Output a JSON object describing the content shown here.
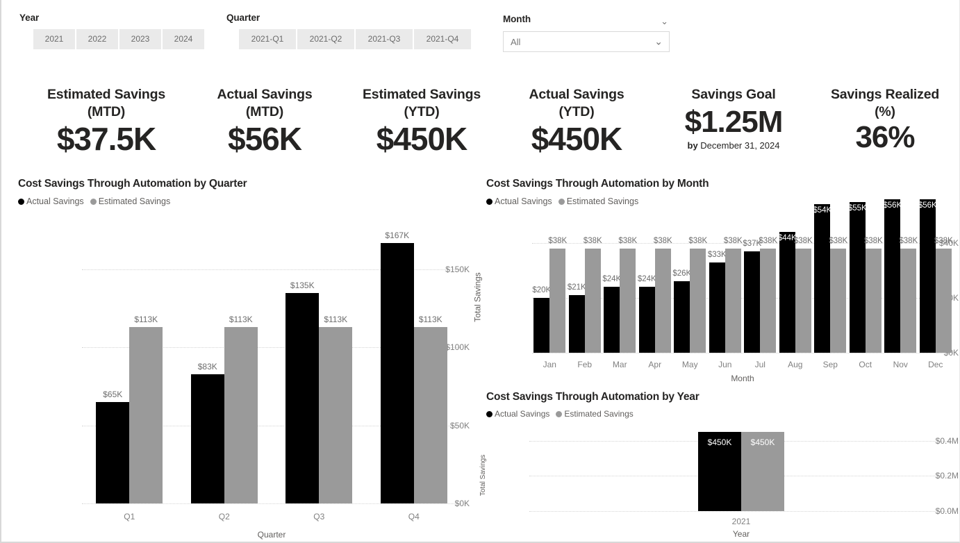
{
  "slicers": {
    "year": {
      "label": "Year",
      "options": [
        "2021",
        "2022",
        "2023",
        "2024"
      ]
    },
    "quarter": {
      "label": "Quarter",
      "options": [
        "2021-Q1",
        "2021-Q2",
        "2021-Q3",
        "2021-Q4"
      ]
    },
    "month": {
      "label": "Month",
      "value": "All",
      "caret_icon": "chevron-down-icon",
      "dropdown_icon": "chevron-down-icon"
    }
  },
  "kpis": [
    {
      "title_line1": "Estimated Savings",
      "title_line2": "(MTD)",
      "value": "$37.5K"
    },
    {
      "title_line1": "Actual Savings",
      "title_line2": "(MTD)",
      "value": "$56K"
    },
    {
      "title_line1": "Estimated Savings",
      "title_line2": "(YTD)",
      "value": "$450K"
    },
    {
      "title_line1": "Actual Savings",
      "title_line2": "(YTD)",
      "value": "$450K"
    },
    {
      "title_line1": "Savings Goal",
      "title_line2": "",
      "value": "$1.25M",
      "sub_prefix": "by",
      "sub_text": "December 31, 2024"
    },
    {
      "title_line1": "Savings Realized",
      "title_line2": "(%)",
      "value": "36%"
    }
  ],
  "colors": {
    "actual": "#000000",
    "estimated": "#9a9a9a",
    "text": "#252423",
    "axis": "#808080",
    "grid": "#d4d4d4"
  },
  "chart_data": [
    {
      "id": "quarter",
      "type": "bar",
      "title": "Cost Savings Through Automation by Quarter",
      "xlabel": "Quarter",
      "ylabel": "Total Savings",
      "categories": [
        "Q1",
        "Q2",
        "Q3",
        "Q4"
      ],
      "series": [
        {
          "name": "Actual Savings",
          "color": "#000000",
          "values": [
            65000,
            83000,
            135000,
            167000
          ],
          "labels": [
            "$65K",
            "$83K",
            "$135K",
            "$167K"
          ]
        },
        {
          "name": "Estimated Savings",
          "color": "#9a9a9a",
          "values": [
            113000,
            113000,
            113000,
            113000
          ],
          "labels": [
            "$113K",
            "$113K",
            "$113K",
            "$113K"
          ]
        }
      ],
      "yticks": [
        0,
        50000,
        100000,
        150000
      ],
      "ytick_labels": [
        "$0K",
        "$50K",
        "$100K",
        "$150K"
      ],
      "ylim": [
        0,
        175000
      ],
      "grid": true,
      "legend_position": "top-left"
    },
    {
      "id": "month",
      "type": "bar",
      "title": "Cost Savings Through Automation by Month",
      "xlabel": "Month",
      "ylabel": "Total Savings",
      "categories": [
        "Jan",
        "Feb",
        "Mar",
        "Apr",
        "May",
        "Jun",
        "Jul",
        "Aug",
        "Sep",
        "Oct",
        "Nov",
        "Dec"
      ],
      "series": [
        {
          "name": "Actual Savings",
          "color": "#000000",
          "values": [
            20000,
            21000,
            24000,
            24000,
            26000,
            33000,
            37000,
            44000,
            54000,
            55000,
            56000,
            56000
          ],
          "labels": [
            "$20K",
            "$21K",
            "$24K",
            "$24K",
            "$26K",
            "$33K",
            "$37K",
            "$44K",
            "$54K",
            "$55K",
            "$56K",
            "$56K"
          ]
        },
        {
          "name": "Estimated Savings",
          "color": "#9a9a9a",
          "values": [
            38000,
            38000,
            38000,
            38000,
            38000,
            38000,
            38000,
            38000,
            38000,
            38000,
            38000,
            38000
          ],
          "labels": [
            "$38K",
            "$38K",
            "$38K",
            "$38K",
            "$38K",
            "$38K",
            "$38K",
            "$38K",
            "$38K",
            "$38K",
            "$38K",
            "$38K"
          ]
        }
      ],
      "yticks": [
        0,
        20000,
        40000
      ],
      "ytick_labels": [
        "$0K",
        "$20K",
        "$40K"
      ],
      "ylim": [
        0,
        44000
      ],
      "grid": true,
      "legend_position": "top-left"
    },
    {
      "id": "year",
      "type": "bar",
      "title": "Cost Savings Through Automation by Year",
      "xlabel": "Year",
      "ylabel": "Total Savings",
      "categories": [
        "2021"
      ],
      "series": [
        {
          "name": "Actual Savings",
          "color": "#000000",
          "values": [
            450000
          ],
          "labels": [
            "$450K"
          ]
        },
        {
          "name": "Estimated Savings",
          "color": "#9a9a9a",
          "values": [
            450000
          ],
          "labels": [
            "$450K"
          ]
        }
      ],
      "yticks": [
        0,
        200000,
        400000
      ],
      "ytick_labels": [
        "$0.0M",
        "$0.2M",
        "$0.4M"
      ],
      "ylim": [
        0,
        450000
      ],
      "grid": true,
      "legend_position": "top-left"
    }
  ]
}
